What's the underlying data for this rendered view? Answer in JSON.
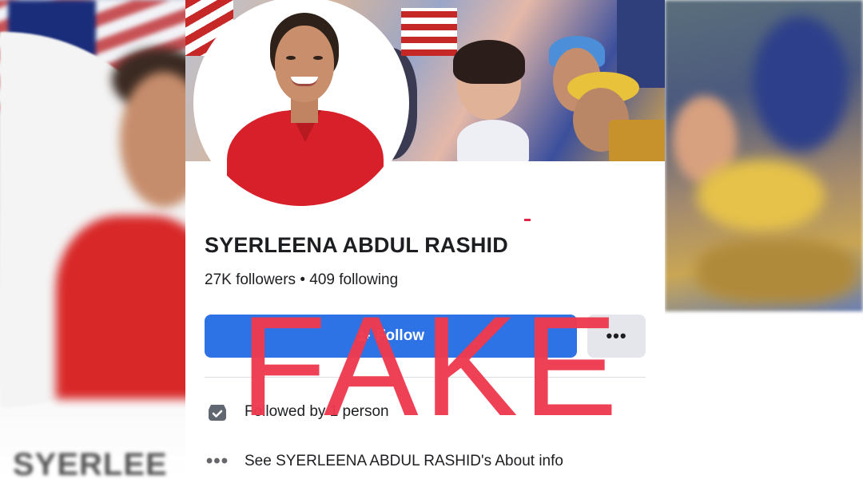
{
  "profile": {
    "name": "SYERLEENA ABDUL RASHID",
    "stats": "27K followers • 409 following"
  },
  "actions": {
    "follow_label": "Follow",
    "more_label": "•••"
  },
  "info": {
    "followed_by": "Followed by 1 person",
    "about": "See SYERLEENA ABDUL RASHID's About info"
  },
  "overlay": {
    "stamp": "FAKE",
    "stamp_color": "#ef3a4f"
  },
  "background": {
    "blurred_text": "SYERLEE"
  },
  "colors": {
    "follow_button": "#2d73e6",
    "more_button": "#e4e6eb"
  }
}
